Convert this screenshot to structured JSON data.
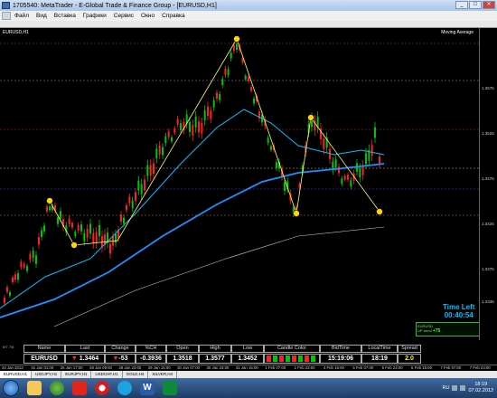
{
  "window": {
    "title": "1705540: MetaTrader - E-Global Trade & Finance Group - [EURUSD,H1]"
  },
  "menu": [
    {
      "label": "Файл"
    },
    {
      "label": "Вид"
    },
    {
      "label": "Вставка"
    },
    {
      "label": "Графики"
    },
    {
      "label": "Сервис"
    },
    {
      "label": "Окно"
    },
    {
      "label": "Справка"
    }
  ],
  "chart": {
    "symbol_label": "EURUSD,H1",
    "indicator_label": "Moving Average",
    "time_left_title": "Time Left",
    "time_left_value": "00:40:54",
    "uptrend_label": "UP trend",
    "uptrend_value": "+75",
    "badge": "EURUSD",
    "price_ticks": [
      "1.3575",
      "1.3525",
      "1.3475",
      "1.3425",
      "1.3375",
      "1.3345"
    ],
    "colors": {
      "bull_candle": "#00c800",
      "bear_candle": "#ff2020",
      "ma_fast": "#1e90ff",
      "ma_slow": "#00bfff",
      "fib_line": "#ffd700",
      "zigzag": "#ffff66"
    }
  },
  "terminal_badge": "MT 7/8",
  "info_panel": {
    "headers": [
      "Name",
      "Last",
      "Change",
      "%CH",
      "Open",
      "High",
      "Low",
      "Candle Color",
      "BidTime",
      "LocalTime",
      "Spread"
    ],
    "values": {
      "name": "EURUSD",
      "last": "1.3464",
      "change": "-53",
      "pch": "-0.3936",
      "open": "1.3518",
      "high": "1.3577",
      "low": "1.3452",
      "bid_time": "15:19:06",
      "local_time": "18:19",
      "spread": "2.0"
    }
  },
  "time_axis": [
    "24 Jan 2013",
    "31 Jan 01:00",
    "25 Jan 17:00",
    "28 Jan 09:00",
    "28 Jan 23:00",
    "29 Jan 15:00",
    "30 Jan 07:00",
    "30 Jan 23:00",
    "31 Jan 15:00",
    "1 Feb 07:00",
    "1 Feb 23:00",
    "4 Feb 15:00",
    "5 Feb 07:00",
    "5 Feb 23:00",
    "6 Feb 15:00",
    "7 Feb 07:00",
    "7 Feb 23:00"
  ],
  "tabs": [
    {
      "label": "EURUSD,H1"
    },
    {
      "label": "USDJPY,H1"
    },
    {
      "label": "EURJPY,H1"
    },
    {
      "label": "USDCHF,H1"
    },
    {
      "label": "GOLD,H4"
    },
    {
      "label": "SILVER,H4"
    }
  ],
  "taskbar": {
    "lang": "RU",
    "time": "18:19",
    "date": "07.02.2013"
  }
}
